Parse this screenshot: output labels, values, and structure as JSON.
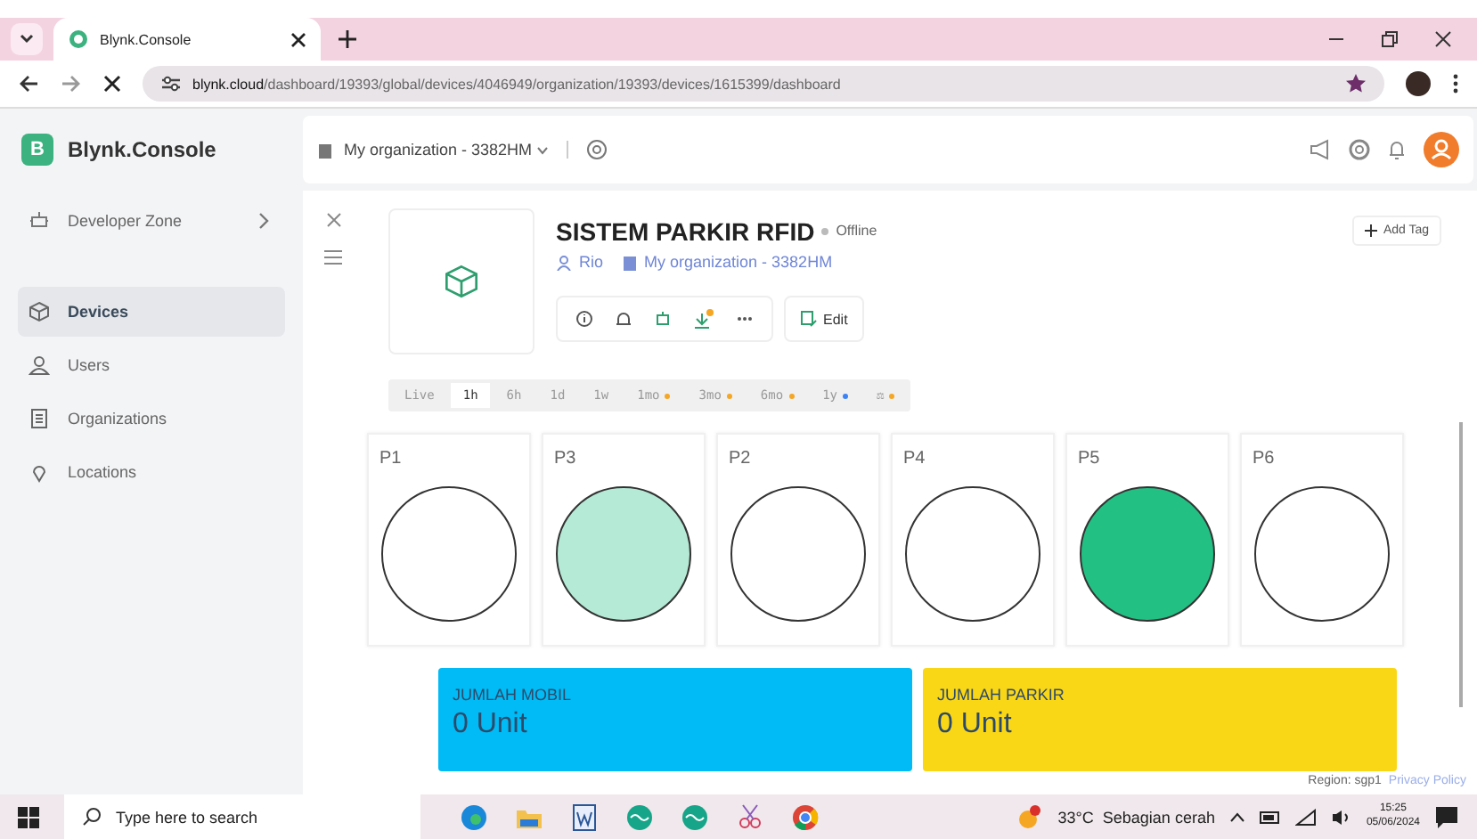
{
  "browser": {
    "tab_title": "Blynk.Console",
    "url_host": "blynk.cloud",
    "url_path": "/dashboard/19393/global/devices/4046949/organization/19393/devices/1615399/dashboard"
  },
  "header": {
    "logo_letter": "B",
    "brand": "Blynk.Console",
    "organization": "My organization - 3382HM"
  },
  "sidebar": {
    "developer_zone": "Developer Zone",
    "items": [
      {
        "label": "Devices",
        "kind": "cube",
        "selected": true
      },
      {
        "label": "Users",
        "kind": "users",
        "selected": false
      },
      {
        "label": "Organizations",
        "kind": "building",
        "selected": false
      },
      {
        "label": "Locations",
        "kind": "pin",
        "selected": false
      }
    ]
  },
  "device": {
    "name": "SISTEM PARKIR RFID",
    "status": "Offline",
    "owner": "Rio",
    "organization": "My organization - 3382HM",
    "edit": "Edit",
    "add_tag": "Add Tag"
  },
  "time_ranges": [
    {
      "label": "Live",
      "selected": false
    },
    {
      "label": "1h",
      "selected": true
    },
    {
      "label": "6h",
      "selected": false
    },
    {
      "label": "1d",
      "selected": false
    },
    {
      "label": "1w",
      "selected": false
    },
    {
      "label": "1mo",
      "selected": false,
      "color": "#f5a623"
    },
    {
      "label": "3mo",
      "selected": false,
      "color": "#f5a623"
    },
    {
      "label": "6mo",
      "selected": false,
      "color": "#f5a623"
    },
    {
      "label": "1y",
      "selected": false,
      "color": "#3b82f6"
    },
    {
      "label": "⚖",
      "selected": false,
      "color": "#f5a623"
    }
  ],
  "leds": [
    {
      "label": "P1",
      "color": "#ffffff"
    },
    {
      "label": "P3",
      "color": "#b5ead7"
    },
    {
      "label": "P2",
      "color": "#ffffff"
    },
    {
      "label": "P4",
      "color": "#ffffff"
    },
    {
      "label": "P5",
      "color": "#23c084"
    },
    {
      "label": "P6",
      "color": "#ffffff"
    }
  ],
  "values": [
    {
      "label": "JUMLAH MOBIL",
      "value": "0 Unit",
      "color": "#00bbf5"
    },
    {
      "label": "JUMLAH PARKIR",
      "value": "0 Unit",
      "color": "#fad716"
    }
  ],
  "footer": {
    "region": "Region: sgp1",
    "privacy": "Privacy Policy"
  },
  "taskbar": {
    "search_placeholder": "Type here to search",
    "weather": "33°C  Sebagian cerah",
    "time": "15:25",
    "date": "05/06/2024"
  }
}
